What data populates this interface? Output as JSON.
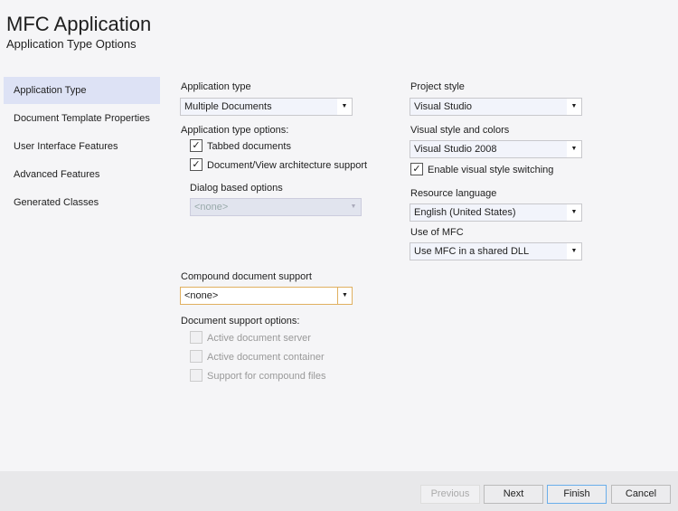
{
  "header": {
    "title": "MFC Application",
    "subtitle": "Application Type Options"
  },
  "nav": [
    "Application Type",
    "Document Template Properties",
    "User Interface Features",
    "Advanced Features",
    "Generated Classes"
  ],
  "app_type": {
    "label": "Application type",
    "value": "Multiple Documents"
  },
  "app_type_options": {
    "label": "Application type options:",
    "tabbed": "Tabbed documents",
    "docview": "Document/View architecture support"
  },
  "dialog": {
    "label": "Dialog based options",
    "value": "<none>"
  },
  "compound": {
    "label": "Compound document support",
    "value": "<none>"
  },
  "doc_support": {
    "label": "Document support options:",
    "items": [
      "Active document server",
      "Active document container",
      "Support for compound files"
    ]
  },
  "project_style": {
    "label": "Project style",
    "value": "Visual Studio"
  },
  "visual_style": {
    "label": "Visual style and colors",
    "value": "Visual Studio 2008",
    "switching": "Enable visual style switching"
  },
  "resource_lang": {
    "label": "Resource language",
    "value": "English (United States)"
  },
  "mfc_use": {
    "label": "Use of MFC",
    "value": "Use MFC in a shared DLL"
  },
  "buttons": {
    "previous": "Previous",
    "next": "Next",
    "finish": "Finish",
    "cancel": "Cancel"
  },
  "check": "✓",
  "arrow": "▼"
}
